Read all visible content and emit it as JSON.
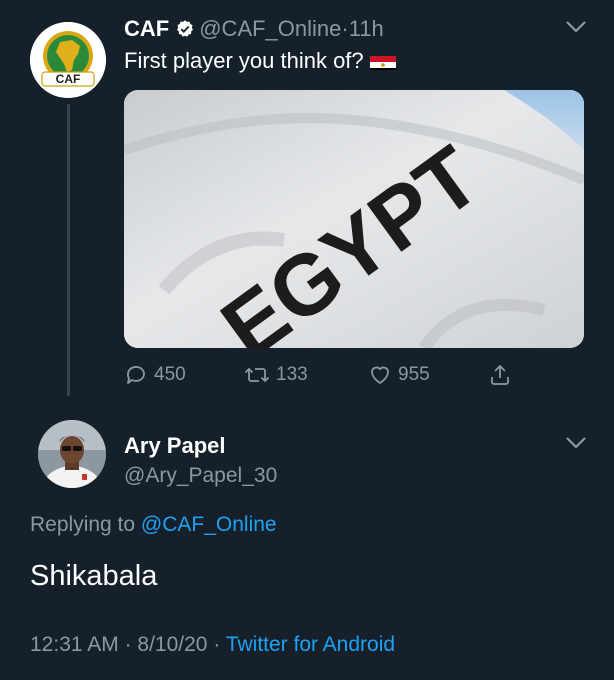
{
  "parent_tweet": {
    "author_name": "CAF",
    "author_handle": "@CAF_Online",
    "separator": "·",
    "time_ago": "11h",
    "avatar_text": "CAF",
    "text": "First player you think of?",
    "flag_icon": "egypt-flag-icon",
    "media_text": "EGYPT",
    "stats": {
      "replies": "450",
      "retweets": "133",
      "likes": "955"
    }
  },
  "reply_tweet": {
    "author_name": "Ary Papel",
    "author_handle": "@Ary_Papel_30",
    "replying_prefix": "Replying to",
    "replying_handle": "@CAF_Online",
    "text": "Shikabala",
    "time": "12:31 AM",
    "sep1": "·",
    "date": "8/10/20",
    "sep2": "·",
    "source": "Twitter for Android"
  },
  "colors": {
    "background": "#15202b",
    "muted": "#8899a6",
    "accent": "#1da1f2"
  }
}
